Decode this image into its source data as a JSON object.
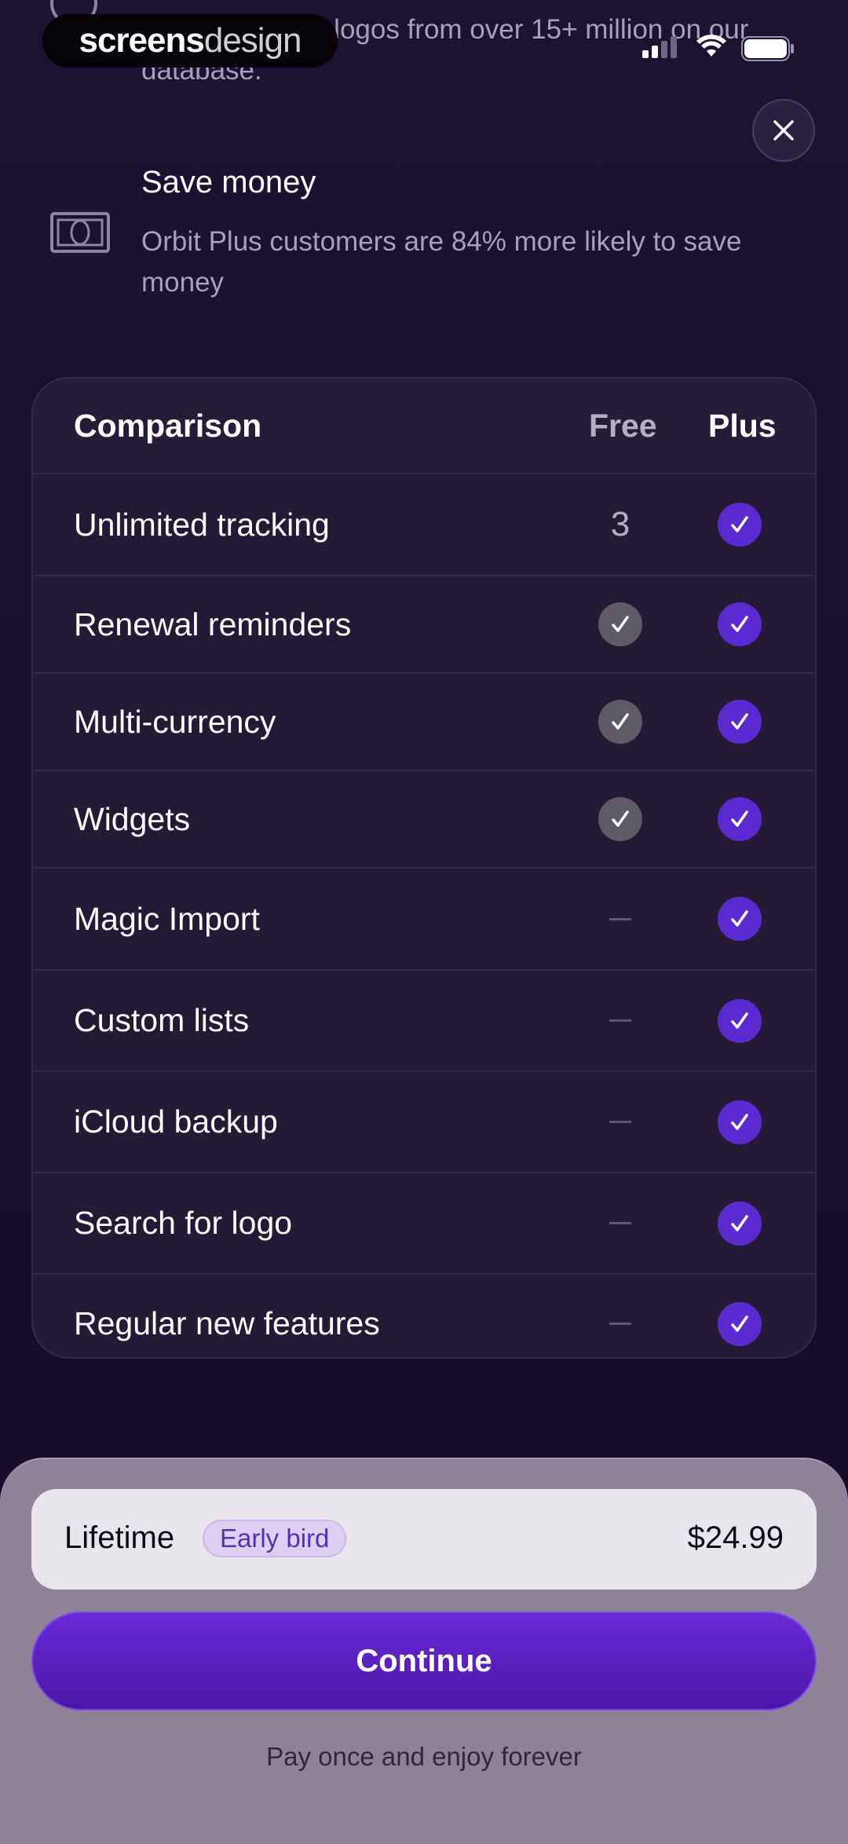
{
  "colors": {
    "background": "#1a0e2c",
    "card": "#241a35",
    "accent": "#5b2ad1",
    "sheet": "#8e8299",
    "badge_bg": "#ddd0f3"
  },
  "brand": {
    "text_bold": "screens",
    "text_light": "design"
  },
  "top_feature": {
    "icon": "circle-icon",
    "description": "Beautiful brand logos from over 15+ million on our database."
  },
  "feature": {
    "icon": "banknote-icon",
    "title": "Save money",
    "description": "Orbit Plus customers are 84% more likely to save money"
  },
  "comparison": {
    "header": {
      "label": "Comparison",
      "free": "Free",
      "plus": "Plus"
    },
    "rows": [
      {
        "label": "Unlimited tracking",
        "free": "3",
        "plus": "check"
      },
      {
        "label": "Renewal reminders",
        "free": "check",
        "plus": "check"
      },
      {
        "label": "Multi-currency",
        "free": "check",
        "plus": "check"
      },
      {
        "label": "Widgets",
        "free": "check",
        "plus": "check"
      },
      {
        "label": "Magic Import",
        "free": "dash",
        "plus": "check"
      },
      {
        "label": "Custom lists",
        "free": "dash",
        "plus": "check"
      },
      {
        "label": "iCloud backup",
        "free": "dash",
        "plus": "check"
      },
      {
        "label": "Search for logo",
        "free": "dash",
        "plus": "check"
      },
      {
        "label": "Regular new features",
        "free": "dash",
        "plus": "check"
      }
    ]
  },
  "plan": {
    "name": "Lifetime",
    "badge": "Early bird",
    "price": "$24.99"
  },
  "cta": {
    "label": "Continue"
  },
  "footnote": "Pay once and enjoy forever"
}
